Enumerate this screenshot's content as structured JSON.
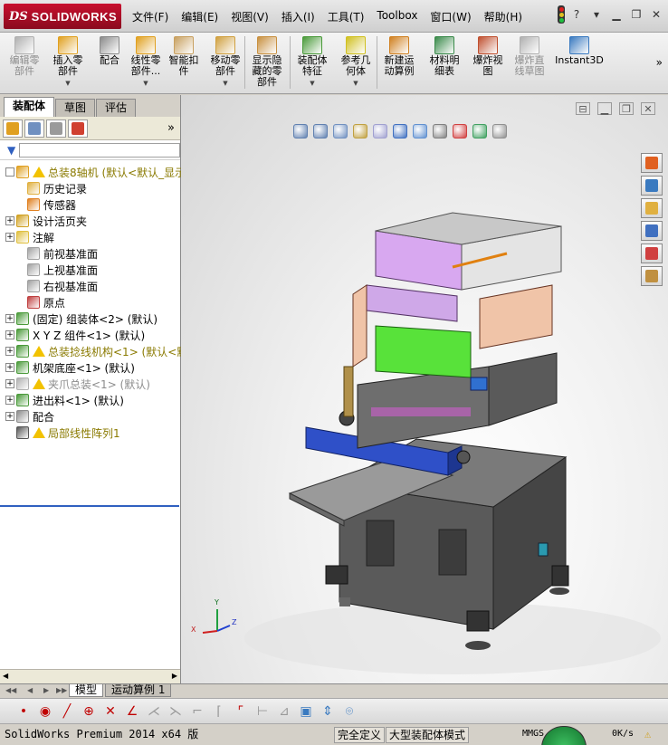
{
  "app": {
    "logo_ds": "DS",
    "logo_name": "SOLIDWORKS"
  },
  "menu": [
    "文件(F)",
    "编辑(E)",
    "视图(V)",
    "插入(I)",
    "工具(T)",
    "Toolbox",
    "窗口(W)",
    "帮助(H)"
  ],
  "window_controls": {
    "help": "?",
    "minimize": "▁",
    "restore": "❐",
    "close": "✕"
  },
  "commands": [
    {
      "label": "编辑零\n部件",
      "icon": "edit-component-icon",
      "color": "#b0b0b0",
      "disabled": true,
      "dropdown": false
    },
    {
      "label": "插入零\n部件",
      "icon": "insert-component-icon",
      "color": "#e0a020",
      "disabled": false,
      "dropdown": true
    },
    {
      "label": "配合",
      "icon": "mate-icon",
      "color": "#8a8a8a",
      "disabled": false,
      "dropdown": false
    },
    {
      "label": "线性零\n部件...",
      "icon": "linear-pattern-icon",
      "color": "#e0a020",
      "disabled": false,
      "dropdown": true
    },
    {
      "label": "智能扣\n件",
      "icon": "smart-fasteners-icon",
      "color": "#c8a060",
      "disabled": false,
      "dropdown": false
    },
    {
      "label": "移动零\n部件",
      "icon": "move-component-icon",
      "color": "#d0a040",
      "disabled": false,
      "dropdown": true
    },
    {
      "label": "显示隐\n藏的零\n部件",
      "icon": "show-hidden-icon",
      "color": "#c89040",
      "disabled": false,
      "dropdown": false
    },
    {
      "label": "装配体\n特征",
      "icon": "assembly-features-icon",
      "color": "#4a9a3a",
      "disabled": false,
      "dropdown": true
    },
    {
      "label": "参考几\n何体",
      "icon": "reference-geometry-icon",
      "color": "#d0c020",
      "disabled": false,
      "dropdown": true
    },
    {
      "label": "新建运\n动算例",
      "icon": "new-motion-study-icon",
      "color": "#d08020",
      "disabled": false,
      "dropdown": false
    },
    {
      "label": "材料明\n细表",
      "icon": "bill-of-materials-icon",
      "color": "#3a8a4a",
      "disabled": false,
      "dropdown": false
    },
    {
      "label": "爆炸视\n图",
      "icon": "exploded-view-icon",
      "color": "#c05030",
      "disabled": false,
      "dropdown": false
    },
    {
      "label": "爆炸直\n线草图",
      "icon": "explode-line-sketch-icon",
      "color": "#b0b0b0",
      "disabled": true,
      "dropdown": false
    },
    {
      "label": "Instant3D",
      "icon": "instant3d-icon",
      "color": "#3a7ac0",
      "disabled": false,
      "dropdown": false
    }
  ],
  "panel_tabs": [
    "装配体",
    "草图",
    "评估"
  ],
  "panel_tools": [
    {
      "icon": "feature-manager-icon",
      "color": "#e0a020"
    },
    {
      "icon": "property-manager-icon",
      "color": "#7090c0"
    },
    {
      "icon": "configuration-manager-icon",
      "color": "#9a9a9a"
    },
    {
      "icon": "display-manager-icon",
      "color": "#d04030"
    }
  ],
  "panel_more": "»",
  "tree": [
    {
      "label": "总装8轴机  (默认<默认_显示状",
      "icon": "assembly-icon",
      "color": "#e0a020",
      "warn": true,
      "expand": "",
      "indent": 0,
      "style": "root"
    },
    {
      "label": "历史记录",
      "icon": "history-icon",
      "color": "#e0b040",
      "warn": false,
      "expand": null,
      "indent": 1,
      "style": ""
    },
    {
      "label": "传感器",
      "icon": "sensor-icon",
      "color": "#e08020",
      "warn": false,
      "expand": null,
      "indent": 1,
      "style": ""
    },
    {
      "label": "设计活页夹",
      "icon": "design-binder-icon",
      "color": "#d0a020",
      "warn": false,
      "expand": "+",
      "indent": 0,
      "style": ""
    },
    {
      "label": "注解",
      "icon": "annotations-icon",
      "color": "#e0c040",
      "warn": false,
      "expand": "+",
      "indent": 0,
      "style": ""
    },
    {
      "label": "前视基准面",
      "icon": "plane-icon",
      "color": "#a0a0a0",
      "warn": false,
      "expand": null,
      "indent": 1,
      "style": ""
    },
    {
      "label": "上视基准面",
      "icon": "plane-icon",
      "color": "#a0a0a0",
      "warn": false,
      "expand": null,
      "indent": 1,
      "style": ""
    },
    {
      "label": "右视基准面",
      "icon": "plane-icon",
      "color": "#a0a0a0",
      "warn": false,
      "expand": null,
      "indent": 1,
      "style": ""
    },
    {
      "label": "原点",
      "icon": "origin-icon",
      "color": "#c04040",
      "warn": false,
      "expand": null,
      "indent": 1,
      "style": ""
    },
    {
      "label": "(固定) 组装体<2> (默认)",
      "icon": "subassembly-icon",
      "color": "#4a9a3a",
      "warn": false,
      "expand": "+",
      "indent": 0,
      "style": ""
    },
    {
      "label": "X Y Z 组件<1> (默认)",
      "icon": "subassembly-icon",
      "color": "#4a9a3a",
      "warn": false,
      "expand": "+",
      "indent": 0,
      "style": ""
    },
    {
      "label": "总装捻线机构<1> (默认<默",
      "icon": "subassembly-icon",
      "color": "#4a9a3a",
      "warn": true,
      "expand": "+",
      "indent": 0,
      "style": "yel"
    },
    {
      "label": "机架底座<1> (默认)",
      "icon": "subassembly-icon",
      "color": "#4a9a3a",
      "warn": false,
      "expand": "+",
      "indent": 0,
      "style": ""
    },
    {
      "label": "夹爪总装<1> (默认)",
      "icon": "subassembly-icon",
      "color": "#b0b0b0",
      "warn": true,
      "expand": "+",
      "indent": 0,
      "style": "gray"
    },
    {
      "label": "进出料<1> (默认)",
      "icon": "subassembly-icon",
      "color": "#4a9a3a",
      "warn": false,
      "expand": "+",
      "indent": 0,
      "style": ""
    },
    {
      "label": "配合",
      "icon": "mates-folder-icon",
      "color": "#8a8a8a",
      "warn": false,
      "expand": "+",
      "indent": 0,
      "style": ""
    },
    {
      "label": "局部线性阵列1",
      "icon": "local-pattern-icon",
      "color": "#555555",
      "warn": true,
      "expand": null,
      "indent": 0,
      "style": "yel"
    }
  ],
  "headsup_tools": [
    {
      "icon": "zoom-to-fit-icon",
      "color": "#6080b0"
    },
    {
      "icon": "zoom-to-area-icon",
      "color": "#6080b0"
    },
    {
      "icon": "previous-view-icon",
      "color": "#7090c0"
    },
    {
      "icon": "section-view-icon",
      "color": "#c0a040"
    },
    {
      "icon": "dynamic-annotation-icon",
      "color": "#a0a0d0"
    },
    {
      "icon": "view-orientation-icon",
      "color": "#4070c0"
    },
    {
      "icon": "display-style-icon",
      "color": "#6090d0"
    },
    {
      "icon": "hide-show-items-icon",
      "color": "#808080"
    },
    {
      "icon": "edit-appearance-icon",
      "color": "#d04040"
    },
    {
      "icon": "apply-scene-icon",
      "color": "#40a060"
    },
    {
      "icon": "view-settings-icon",
      "color": "#909090"
    }
  ],
  "taskpane": [
    {
      "icon": "solidworks-resources-icon",
      "color": "#e06020"
    },
    {
      "icon": "design-library-icon",
      "color": "#3a7ac0"
    },
    {
      "icon": "file-explorer-icon",
      "color": "#e0b040"
    },
    {
      "icon": "view-palette-icon",
      "color": "#4070c0"
    },
    {
      "icon": "appearances-scenes-icon",
      "color": "#d04040"
    },
    {
      "icon": "custom-properties-icon",
      "color": "#c09040"
    }
  ],
  "triad": {
    "x": "X",
    "y": "Y",
    "z": "Z"
  },
  "bottom_tabs": [
    "模型",
    "运动算例 1"
  ],
  "sketch_tools": [
    {
      "icon": "point-icon",
      "glyph": "•",
      "color": "#c00000"
    },
    {
      "icon": "circle-center-icon",
      "glyph": "◉",
      "color": "#c00000"
    },
    {
      "icon": "line-icon",
      "glyph": "╱",
      "color": "#c00000"
    },
    {
      "icon": "circle-icon",
      "glyph": "⊕",
      "color": "#c00000"
    },
    {
      "icon": "trim-icon",
      "glyph": "✕",
      "color": "#c00000"
    },
    {
      "icon": "angle-icon",
      "glyph": "∠",
      "color": "#c00000"
    },
    {
      "icon": "sketch-tool-a-icon",
      "glyph": "⋌",
      "color": "#999999"
    },
    {
      "icon": "sketch-tool-b-icon",
      "glyph": "⋋",
      "color": "#999999"
    },
    {
      "icon": "sketch-tool-c-icon",
      "glyph": "⌐",
      "color": "#999999"
    },
    {
      "icon": "sketch-tool-d-icon",
      "glyph": "⌈",
      "color": "#999999"
    },
    {
      "icon": "sketch-tool-e-icon",
      "glyph": "⌜",
      "color": "#c00000"
    },
    {
      "icon": "dimension-icon",
      "glyph": "⊢",
      "color": "#999999"
    },
    {
      "icon": "relation-icon",
      "glyph": "⊿",
      "color": "#999999"
    },
    {
      "icon": "cube-icon",
      "glyph": "▣",
      "color": "#3a7ac0"
    },
    {
      "icon": "arrow-icon",
      "glyph": "⇕",
      "color": "#3a7ac0"
    },
    {
      "icon": "camera-icon",
      "glyph": "⌾",
      "color": "#3a7ac0"
    }
  ],
  "status": {
    "app_version": "SolidWorks Premium 2014 x64 版",
    "definition": "完全定义",
    "mode": "大型装配体模式",
    "units": "MMGS",
    "rate": "0K/s"
  }
}
